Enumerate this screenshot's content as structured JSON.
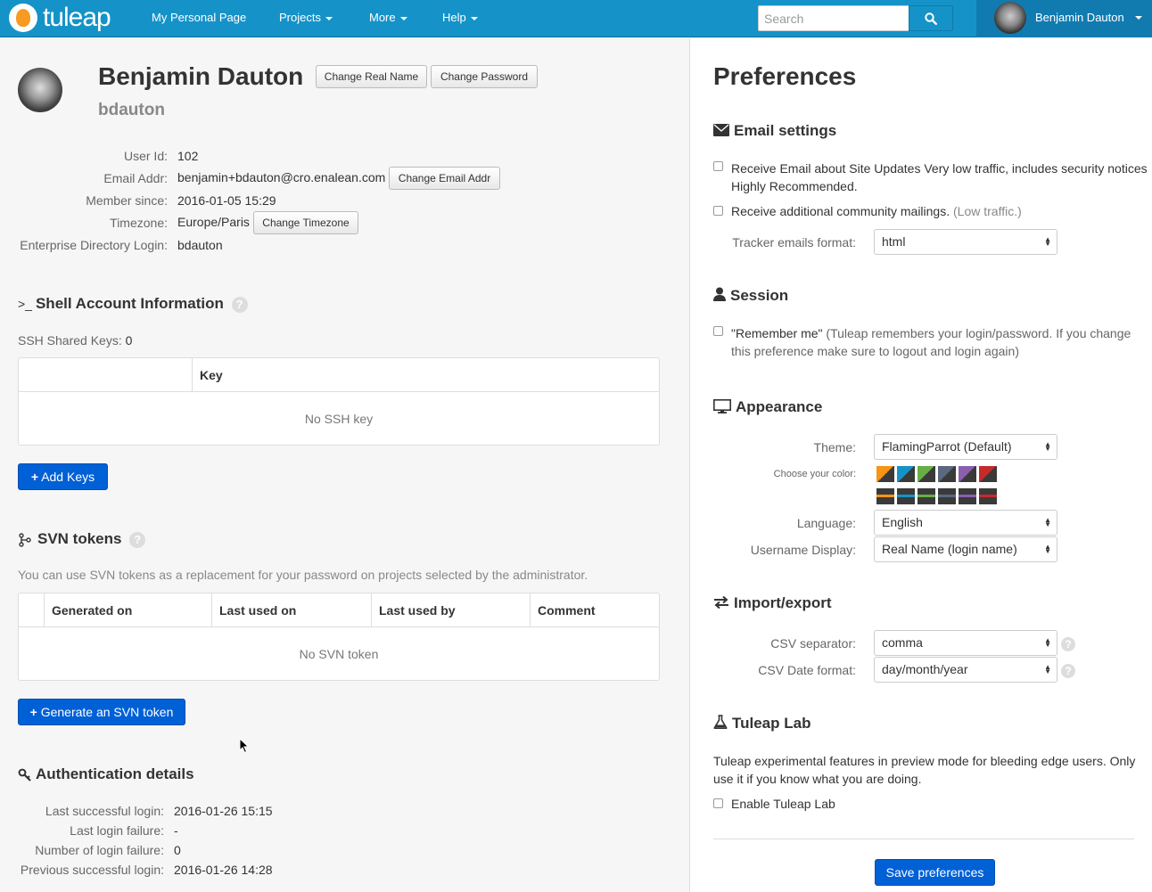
{
  "topbar": {
    "logo_text": "tuleap",
    "nav": [
      {
        "label": "My Personal Page"
      },
      {
        "label": "Projects"
      },
      {
        "label": "More"
      },
      {
        "label": "Help"
      }
    ],
    "search_placeholder": "Search",
    "user_name": "Benjamin Dauton"
  },
  "profile": {
    "real_name": "Benjamin Dauton",
    "login": "bdauton",
    "change_real_name": "Change Real Name",
    "change_password": "Change Password",
    "fields": [
      {
        "label": "User Id:",
        "value": "102"
      },
      {
        "label": "Email Addr:",
        "value": "benjamin+bdauton@cro.enalean.com"
      },
      {
        "label": "Member since:",
        "value": "2016-01-05 15:29"
      },
      {
        "label": "Timezone:",
        "value": "Europe/Paris"
      },
      {
        "label": "Enterprise Directory Login:",
        "value": "bdauton"
      }
    ],
    "change_email": "Change Email Addr",
    "change_timezone": "Change Timezone"
  },
  "shell": {
    "prompt": ">_",
    "title": "Shell Account Information",
    "ssh_label": "SSH Shared Keys:",
    "ssh_count": "0",
    "table_header_key": "Key",
    "empty": "No SSH key",
    "add_keys": "Add Keys"
  },
  "svn": {
    "title": "SVN tokens",
    "description": "You can use SVN tokens as a replacement for your password on projects selected by the administrator.",
    "columns": [
      "Generated on",
      "Last used on",
      "Last used by",
      "Comment"
    ],
    "empty": "No SVN token",
    "generate": "Generate an SVN token"
  },
  "auth": {
    "title": "Authentication details",
    "rows": [
      {
        "label": "Last successful login:",
        "value": "2016-01-26 15:15"
      },
      {
        "label": "Last login failure:",
        "value": "-"
      },
      {
        "label": "Number of login failure:",
        "value": "0"
      },
      {
        "label": "Previous successful login:",
        "value": "2016-01-26 14:28"
      }
    ]
  },
  "prefs": {
    "title": "Preferences",
    "email": {
      "title": "Email settings",
      "site_updates_1": "Receive Email about Site Updates Very low traffic, includes security notices",
      "site_updates_2": "Highly Recommended.",
      "community": "Receive additional community mailings.",
      "community_note": "(Low traffic.)",
      "tracker_format_label": "Tracker emails format:",
      "tracker_format_value": "html"
    },
    "session": {
      "title": "Session",
      "remember_1_strong": "\"Remember me\"",
      "remember_1_rest": "(Tuleap remembers your login/password. If you change",
      "remember_2": "this preference make sure to logout and login again)"
    },
    "appearance": {
      "title": "Appearance",
      "theme_label": "Theme:",
      "theme_value": "FlamingParrot (Default)",
      "color_label": "Choose your color:",
      "colors": [
        "#f79514",
        "#1593c8",
        "#67af45",
        "#5a6880",
        "#8c5eb0",
        "#c62b2b"
      ],
      "language_label": "Language:",
      "language_value": "English",
      "username_label": "Username Display:",
      "username_value": "Real Name (login name)"
    },
    "import_export": {
      "title": "Import/export",
      "csv_sep_label": "CSV separator:",
      "csv_sep_value": "comma",
      "csv_date_label": "CSV Date format:",
      "csv_date_value": "day/month/year"
    },
    "lab": {
      "title": "Tuleap Lab",
      "desc_1": "Tuleap experimental features in preview mode for bleeding edge users. Only",
      "desc_2": "use it if you know what you are doing.",
      "enable": "Enable Tuleap Lab"
    },
    "save": "Save preferences"
  }
}
